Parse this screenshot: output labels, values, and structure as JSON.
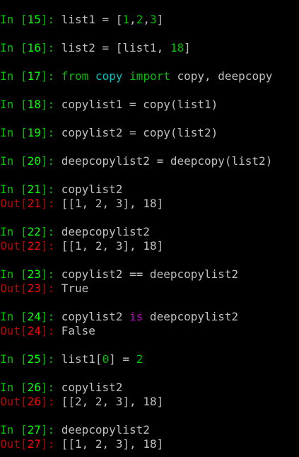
{
  "console": {
    "cells": [
      {
        "n": "15",
        "tokens": [
          {
            "t": "list1 = [",
            "c": "code"
          },
          {
            "t": "1",
            "c": "numlit"
          },
          {
            "t": ",",
            "c": "code"
          },
          {
            "t": "2",
            "c": "numlit"
          },
          {
            "t": ",",
            "c": "code"
          },
          {
            "t": "3",
            "c": "numlit"
          },
          {
            "t": "]",
            "c": "code"
          }
        ],
        "out": null
      },
      {
        "n": "16",
        "tokens": [
          {
            "t": "list2 = [list1, ",
            "c": "code"
          },
          {
            "t": "18",
            "c": "numlit"
          },
          {
            "t": "]",
            "c": "code"
          }
        ],
        "out": null
      },
      {
        "n": "17",
        "tokens": [
          {
            "t": "from",
            "c": "kw"
          },
          {
            "t": " ",
            "c": "code"
          },
          {
            "t": "copy",
            "c": "mod"
          },
          {
            "t": " ",
            "c": "code"
          },
          {
            "t": "import",
            "c": "kw"
          },
          {
            "t": " copy, deepcopy",
            "c": "code"
          }
        ],
        "out": null
      },
      {
        "n": "18",
        "tokens": [
          {
            "t": "copylist1 = copy(list1)",
            "c": "code"
          }
        ],
        "out": null
      },
      {
        "n": "19",
        "tokens": [
          {
            "t": "copylist2 = copy(list2)",
            "c": "code"
          }
        ],
        "out": null
      },
      {
        "n": "20",
        "tokens": [
          {
            "t": "deepcopylist2 = deepcopy(list2)",
            "c": "code"
          }
        ],
        "out": null
      },
      {
        "n": "21",
        "tokens": [
          {
            "t": "copylist2",
            "c": "code"
          }
        ],
        "out": "[[1, 2, 3], 18]"
      },
      {
        "n": "22",
        "tokens": [
          {
            "t": "deepcopylist2",
            "c": "code"
          }
        ],
        "out": "[[1, 2, 3], 18]"
      },
      {
        "n": "23",
        "tokens": [
          {
            "t": "copylist2 == deepcopylist2",
            "c": "code"
          }
        ],
        "out": "True"
      },
      {
        "n": "24",
        "tokens": [
          {
            "t": "copylist2 ",
            "c": "code"
          },
          {
            "t": "is",
            "c": "op-kw"
          },
          {
            "t": " deepcopylist2",
            "c": "code"
          }
        ],
        "out": "False"
      },
      {
        "n": "25",
        "tokens": [
          {
            "t": "list1[",
            "c": "code"
          },
          {
            "t": "0",
            "c": "numlit"
          },
          {
            "t": "] = ",
            "c": "code"
          },
          {
            "t": "2",
            "c": "numlit"
          }
        ],
        "out": null
      },
      {
        "n": "26",
        "tokens": [
          {
            "t": "copylist2",
            "c": "code"
          }
        ],
        "out": "[[2, 2, 3], 18]"
      },
      {
        "n": "27",
        "tokens": [
          {
            "t": "deepcopylist2",
            "c": "code"
          }
        ],
        "out": "[[1, 2, 3], 18]"
      }
    ],
    "in_label": "In",
    "out_label": "Out",
    "colors": {
      "background": "#000000",
      "text": "#c0c0c0",
      "prompt_in": "#00c000",
      "prompt_in_number": "#00ff00",
      "prompt_out": "#c00000",
      "prompt_out_number": "#ff0000",
      "number_literal": "#00c000",
      "keyword": "#00c000",
      "module": "#00c0c0",
      "operator_keyword": "#c000c0"
    }
  }
}
